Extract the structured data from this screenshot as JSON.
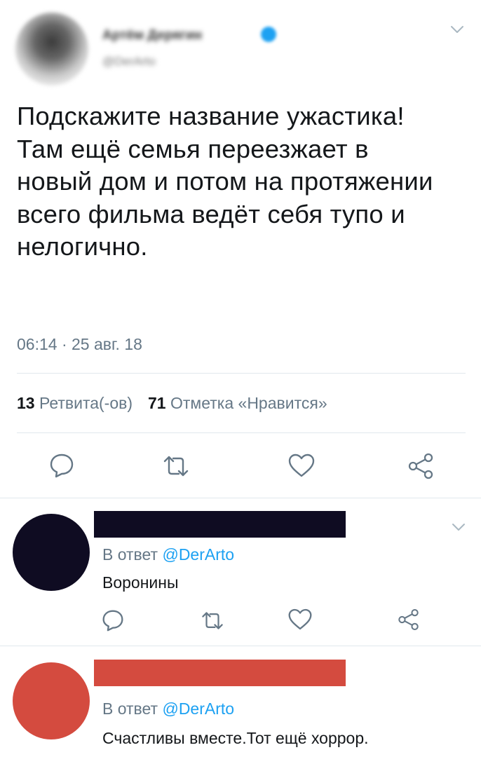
{
  "tweet": {
    "author_name": "Артём Дерягин",
    "author_handle": "@DerArto",
    "text": "Подскажите название ужастика! Там ещё семья переезжает в новый дом и потом на протяжении всего фильма ведёт себя тупо и нелогично.",
    "timestamp": "06:14 · 25 авг. 18",
    "retweets_count": "13",
    "retweets_label": "Ретвита(-ов)",
    "likes_count": "71",
    "likes_label": "Отметка «Нравится»"
  },
  "replies": [
    {
      "avatar_color": "#0f0c22",
      "name_bar_color": "#0f0c22",
      "reply_prefix": "В ответ",
      "reply_to": "@DerArto",
      "text": "Воронины"
    },
    {
      "avatar_color": "#d44b3f",
      "name_bar_color": "#d44b3f",
      "reply_prefix": "В ответ",
      "reply_to": "@DerArto",
      "text": "Счастливы вместе.Тот ещё хоррор."
    }
  ],
  "colors": {
    "accent": "#1da1f2",
    "secondary_text": "#657786",
    "icon": "#657786",
    "divider": "#e1e8ed"
  },
  "icons": [
    "chevron-down-icon",
    "reply-icon",
    "retweet-icon",
    "heart-icon",
    "share-icon"
  ]
}
